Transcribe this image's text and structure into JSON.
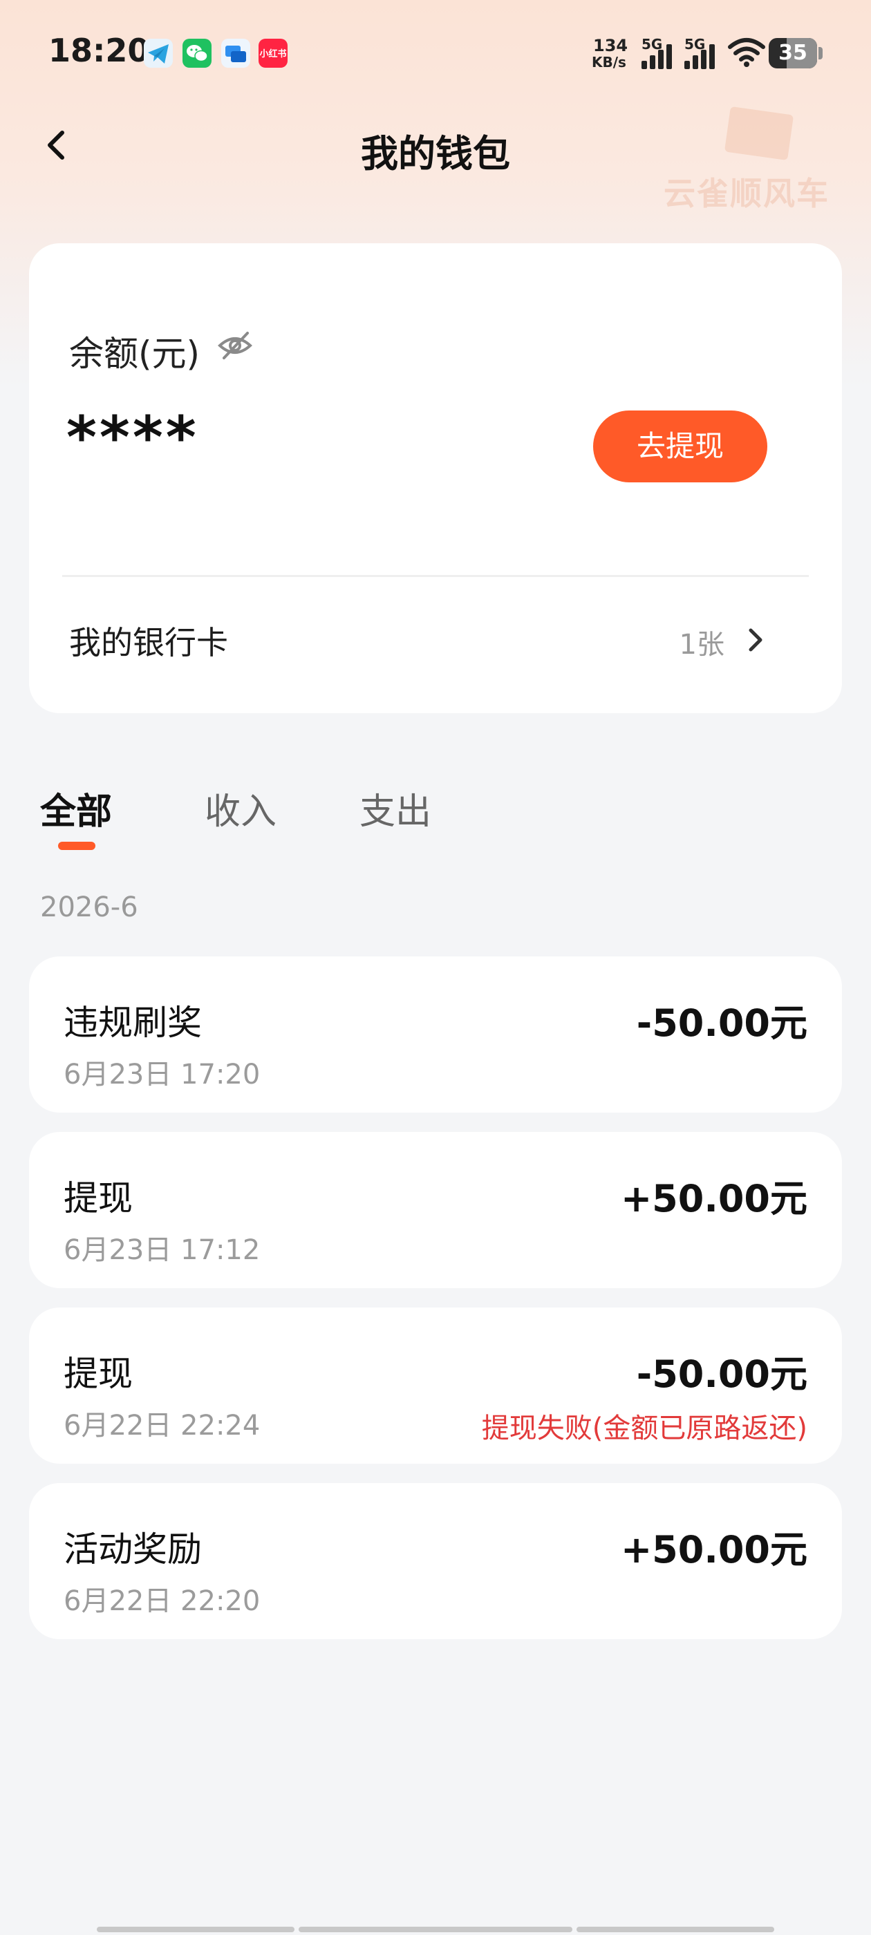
{
  "status_bar": {
    "time": "18:20",
    "notification_icons": [
      "telegram-icon",
      "wechat-icon",
      "messenger-icon",
      "xiaohongshu-icon"
    ],
    "xiaohongshu_label": "小红书",
    "net_speed": "134",
    "net_speed_unit": "KB/s",
    "sim1": "5G",
    "sim2": "5G",
    "battery": "35"
  },
  "header": {
    "title": "我的钱包",
    "watermark": "云雀顺风车"
  },
  "balance_card": {
    "label": "余额(元)",
    "value": "****",
    "withdraw_button": "去提现",
    "bank_card_label": "我的银行卡",
    "bank_card_count": "1张"
  },
  "tabs": [
    {
      "label": "全部",
      "active": true
    },
    {
      "label": "收入",
      "active": false
    },
    {
      "label": "支出",
      "active": false
    }
  ],
  "month": "2026-6",
  "records": [
    {
      "title": "违规刷奖",
      "time": "6月23日 17:20",
      "amount": "-50.00元",
      "note": ""
    },
    {
      "title": "提现",
      "time": "6月23日 17:12",
      "amount": "+50.00元",
      "note": ""
    },
    {
      "title": "提现",
      "time": "6月22日 22:24",
      "amount": "-50.00元",
      "note": "提现失败(金额已原路返还)"
    },
    {
      "title": "活动奖励",
      "time": "6月22日 22:20",
      "amount": "+50.00元",
      "note": ""
    }
  ],
  "colors": {
    "accent": "#ff5a28",
    "error": "#e23a3a",
    "background": "#f4f5f7"
  }
}
